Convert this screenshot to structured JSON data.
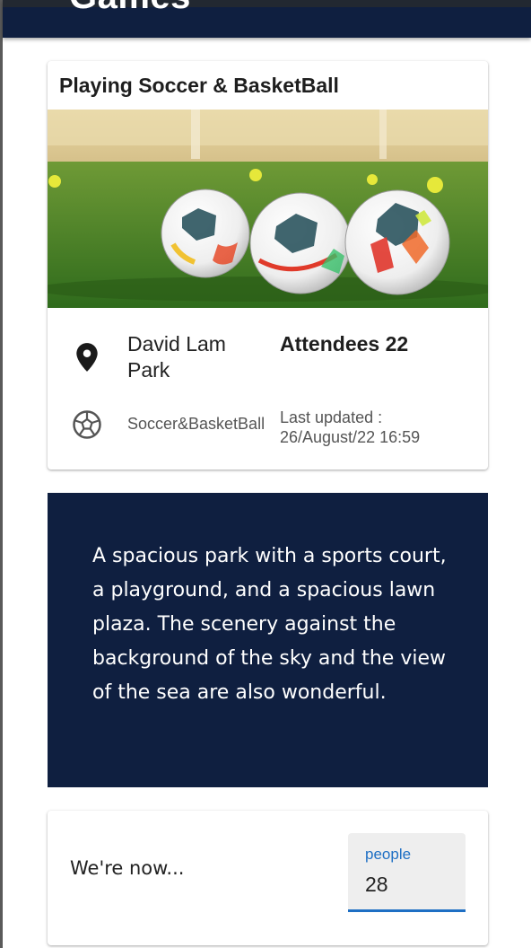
{
  "app_bar": {
    "title": "Games"
  },
  "event": {
    "title": "Playing Soccer & BasketBall",
    "image_alt": "three soccer balls on grass field",
    "location": "David Lam Park",
    "attendees": "Attendees 22",
    "sport": "Soccer&BasketBall",
    "last_updated_label": "Last updated :",
    "last_updated_value": "26/August/22 16:59",
    "icons": {
      "location": "location-pin-icon",
      "sport": "soccer-ball-icon"
    }
  },
  "description": {
    "text": "A spacious park with a sports court, a playground, and a spacious lawn plaza. The scenery against the background of the sky and the view of the sea are also wonderful."
  },
  "status": {
    "label": "We're now...",
    "field_label": "people",
    "field_value": "28"
  },
  "colors": {
    "navy": "#0f1f40",
    "accent_blue": "#1e6fc4",
    "field_bg": "#eeeeee"
  }
}
